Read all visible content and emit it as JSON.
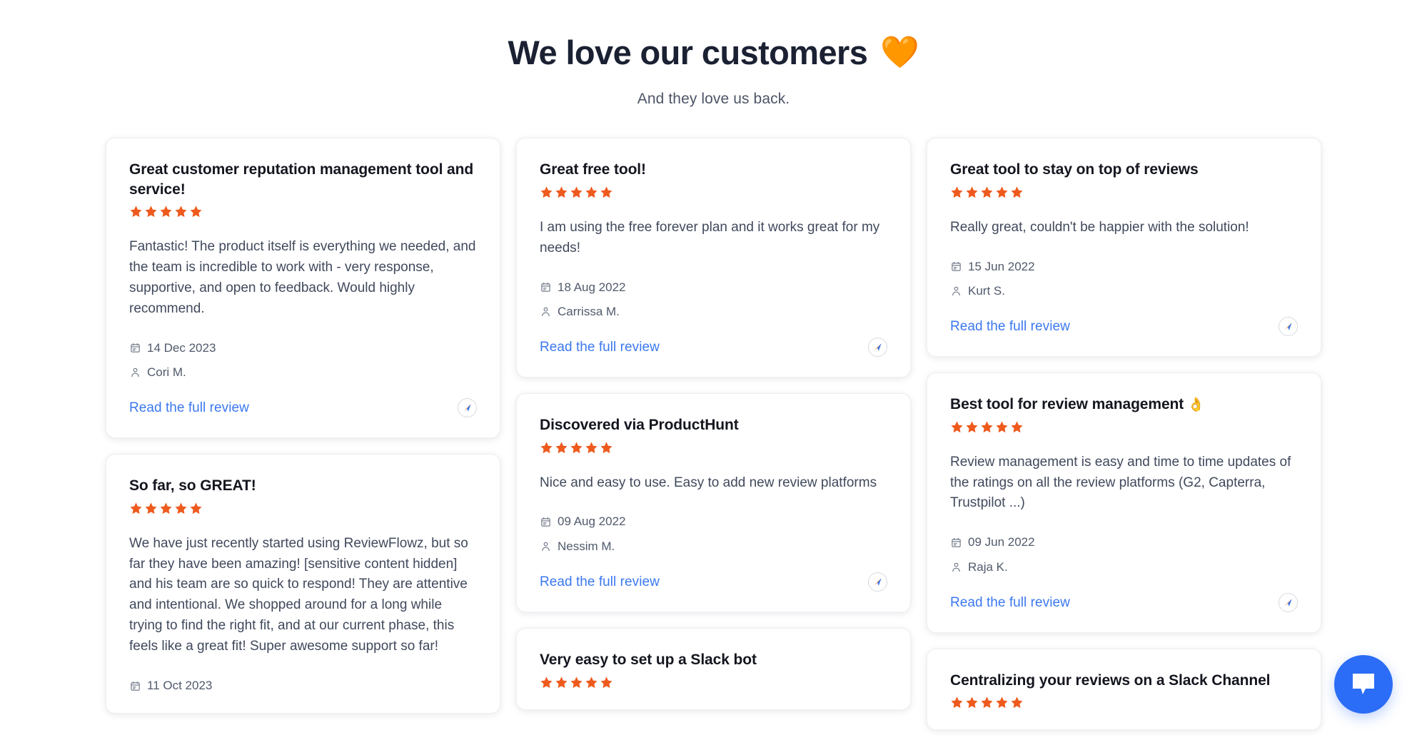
{
  "header": {
    "title": "We love our customers",
    "title_emoji": "🧡",
    "subtitle": "And they love us back."
  },
  "colors": {
    "star": "#ee5a1d",
    "heart": "#f7914d",
    "link": "#3b78ef",
    "title": "#14161f",
    "body": "#40495c",
    "chat_bubble": "#2b6df6"
  },
  "labels": {
    "read_link": "Read the full review",
    "calendar_icon": "calendar-icon",
    "user_icon": "user-icon",
    "source_icon": "capterra-compass-icon",
    "chat_icon": "chat-bubble-icon"
  },
  "columns": [
    {
      "cards": [
        {
          "title": "Great customer reputation management tool and service!",
          "emoji": "",
          "rating": 5,
          "body": "Fantastic! The product itself is everything we needed, and the team is incredible to work with - very response, supportive, and open to feedback. Would highly recommend.",
          "date": "14 Dec 2023",
          "author": "Cori M.",
          "link": "Read the full review",
          "has_footer": true
        },
        {
          "title": "So far, so GREAT!",
          "emoji": "",
          "rating": 5,
          "body": "We have just recently started using ReviewFlowz, but so far they have been amazing! [sensitive content hidden] and his team are so quick to respond! They are attentive and intentional. We shopped around for a long while trying to find the right fit, and at our current phase, this feels like a great fit! Super awesome support so far!",
          "date": "11 Oct 2023",
          "author": "",
          "link": "",
          "has_footer": false
        }
      ]
    },
    {
      "cards": [
        {
          "title": "Great free tool!",
          "emoji": "",
          "rating": 5,
          "body": "I am using the free forever plan and it works great for my needs!",
          "date": "18 Aug 2022",
          "author": "Carrissa M.",
          "link": "Read the full review",
          "has_footer": true
        },
        {
          "title": "Discovered via ProductHunt",
          "emoji": "",
          "rating": 5,
          "body": "Nice and easy to use. Easy to add new review platforms",
          "date": "09 Aug 2022",
          "author": "Nessim M.",
          "link": "Read the full review",
          "has_footer": true
        },
        {
          "title": "Very easy to set up a Slack bot",
          "emoji": "",
          "rating": 5,
          "body": "",
          "date": "",
          "author": "",
          "link": "",
          "has_footer": false
        }
      ]
    },
    {
      "cards": [
        {
          "title": "Great tool to stay on top of reviews",
          "emoji": "",
          "rating": 5,
          "body": "Really great, couldn't be happier with the solution!",
          "date": "15 Jun 2022",
          "author": "Kurt S.",
          "link": "Read the full review",
          "has_footer": true
        },
        {
          "title": "Best tool for review management",
          "emoji": "👌",
          "rating": 5,
          "body": "Review management is easy and time to time updates of the ratings on all the review platforms (G2, Capterra, Trustpilot ...)",
          "date": "09 Jun 2022",
          "author": "Raja K.",
          "link": "Read the full review",
          "has_footer": true
        },
        {
          "title": "Centralizing your reviews on a Slack Channel",
          "emoji": "",
          "rating": 5,
          "body": "",
          "date": "",
          "author": "",
          "link": "",
          "has_footer": false
        }
      ]
    }
  ]
}
